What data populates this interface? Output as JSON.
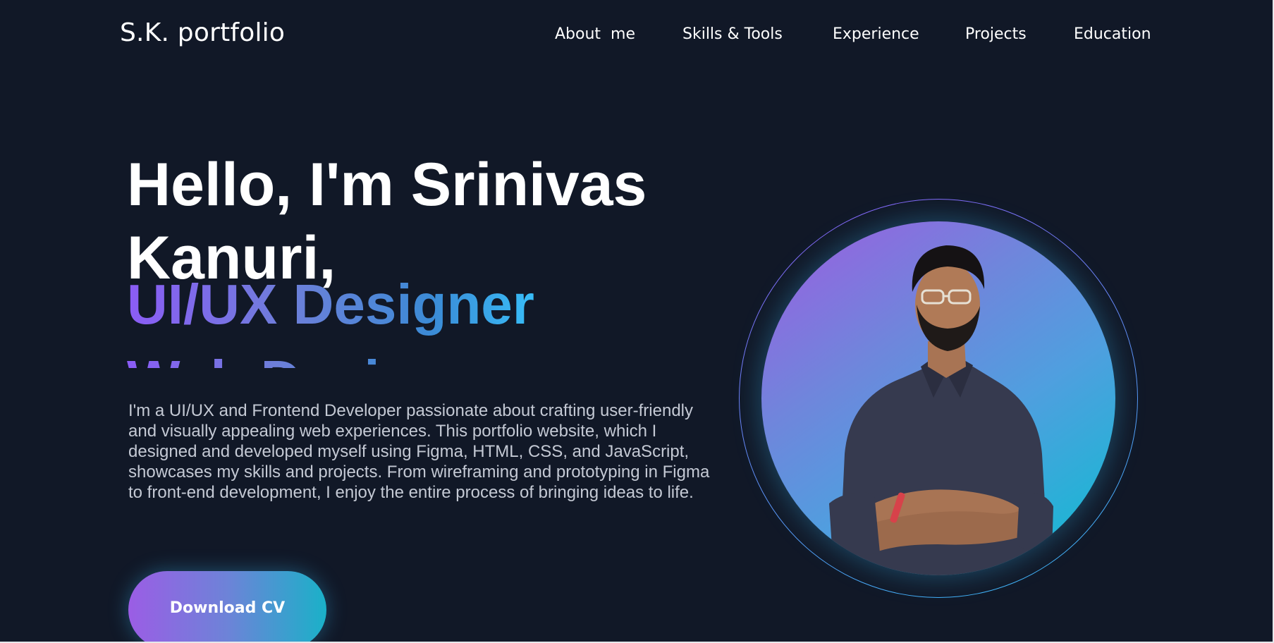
{
  "header": {
    "logo": "S.K. portfolio",
    "nav": [
      {
        "label": "About  me"
      },
      {
        "label": "Skills & Tools"
      },
      {
        "label": "Experience"
      },
      {
        "label": "Projects"
      },
      {
        "label": "Education"
      }
    ]
  },
  "hero": {
    "greeting": "Hello, I'm Srinivas Kanuri,",
    "roles": [
      "UI/UX Designer",
      "Web Designer"
    ],
    "intro": "I'm a UI/UX and Frontend Developer passionate about crafting user-friendly and visually appealing web experiences. This portfolio website, which I designed and developed myself using Figma, HTML, CSS, and JavaScript, showcases my skills and projects. From wireframing and prototyping in Figma to front-end development, I enjoy the entire process of bringing ideas to life.",
    "cta_label": "Download CV"
  },
  "portrait": {
    "subject": "profile-photo"
  },
  "colors": {
    "background": "#111827",
    "gradient_start": "#9b5de5",
    "gradient_end": "#1ab1c8",
    "text_primary": "#ffffff",
    "text_secondary": "#c4c9d4"
  }
}
